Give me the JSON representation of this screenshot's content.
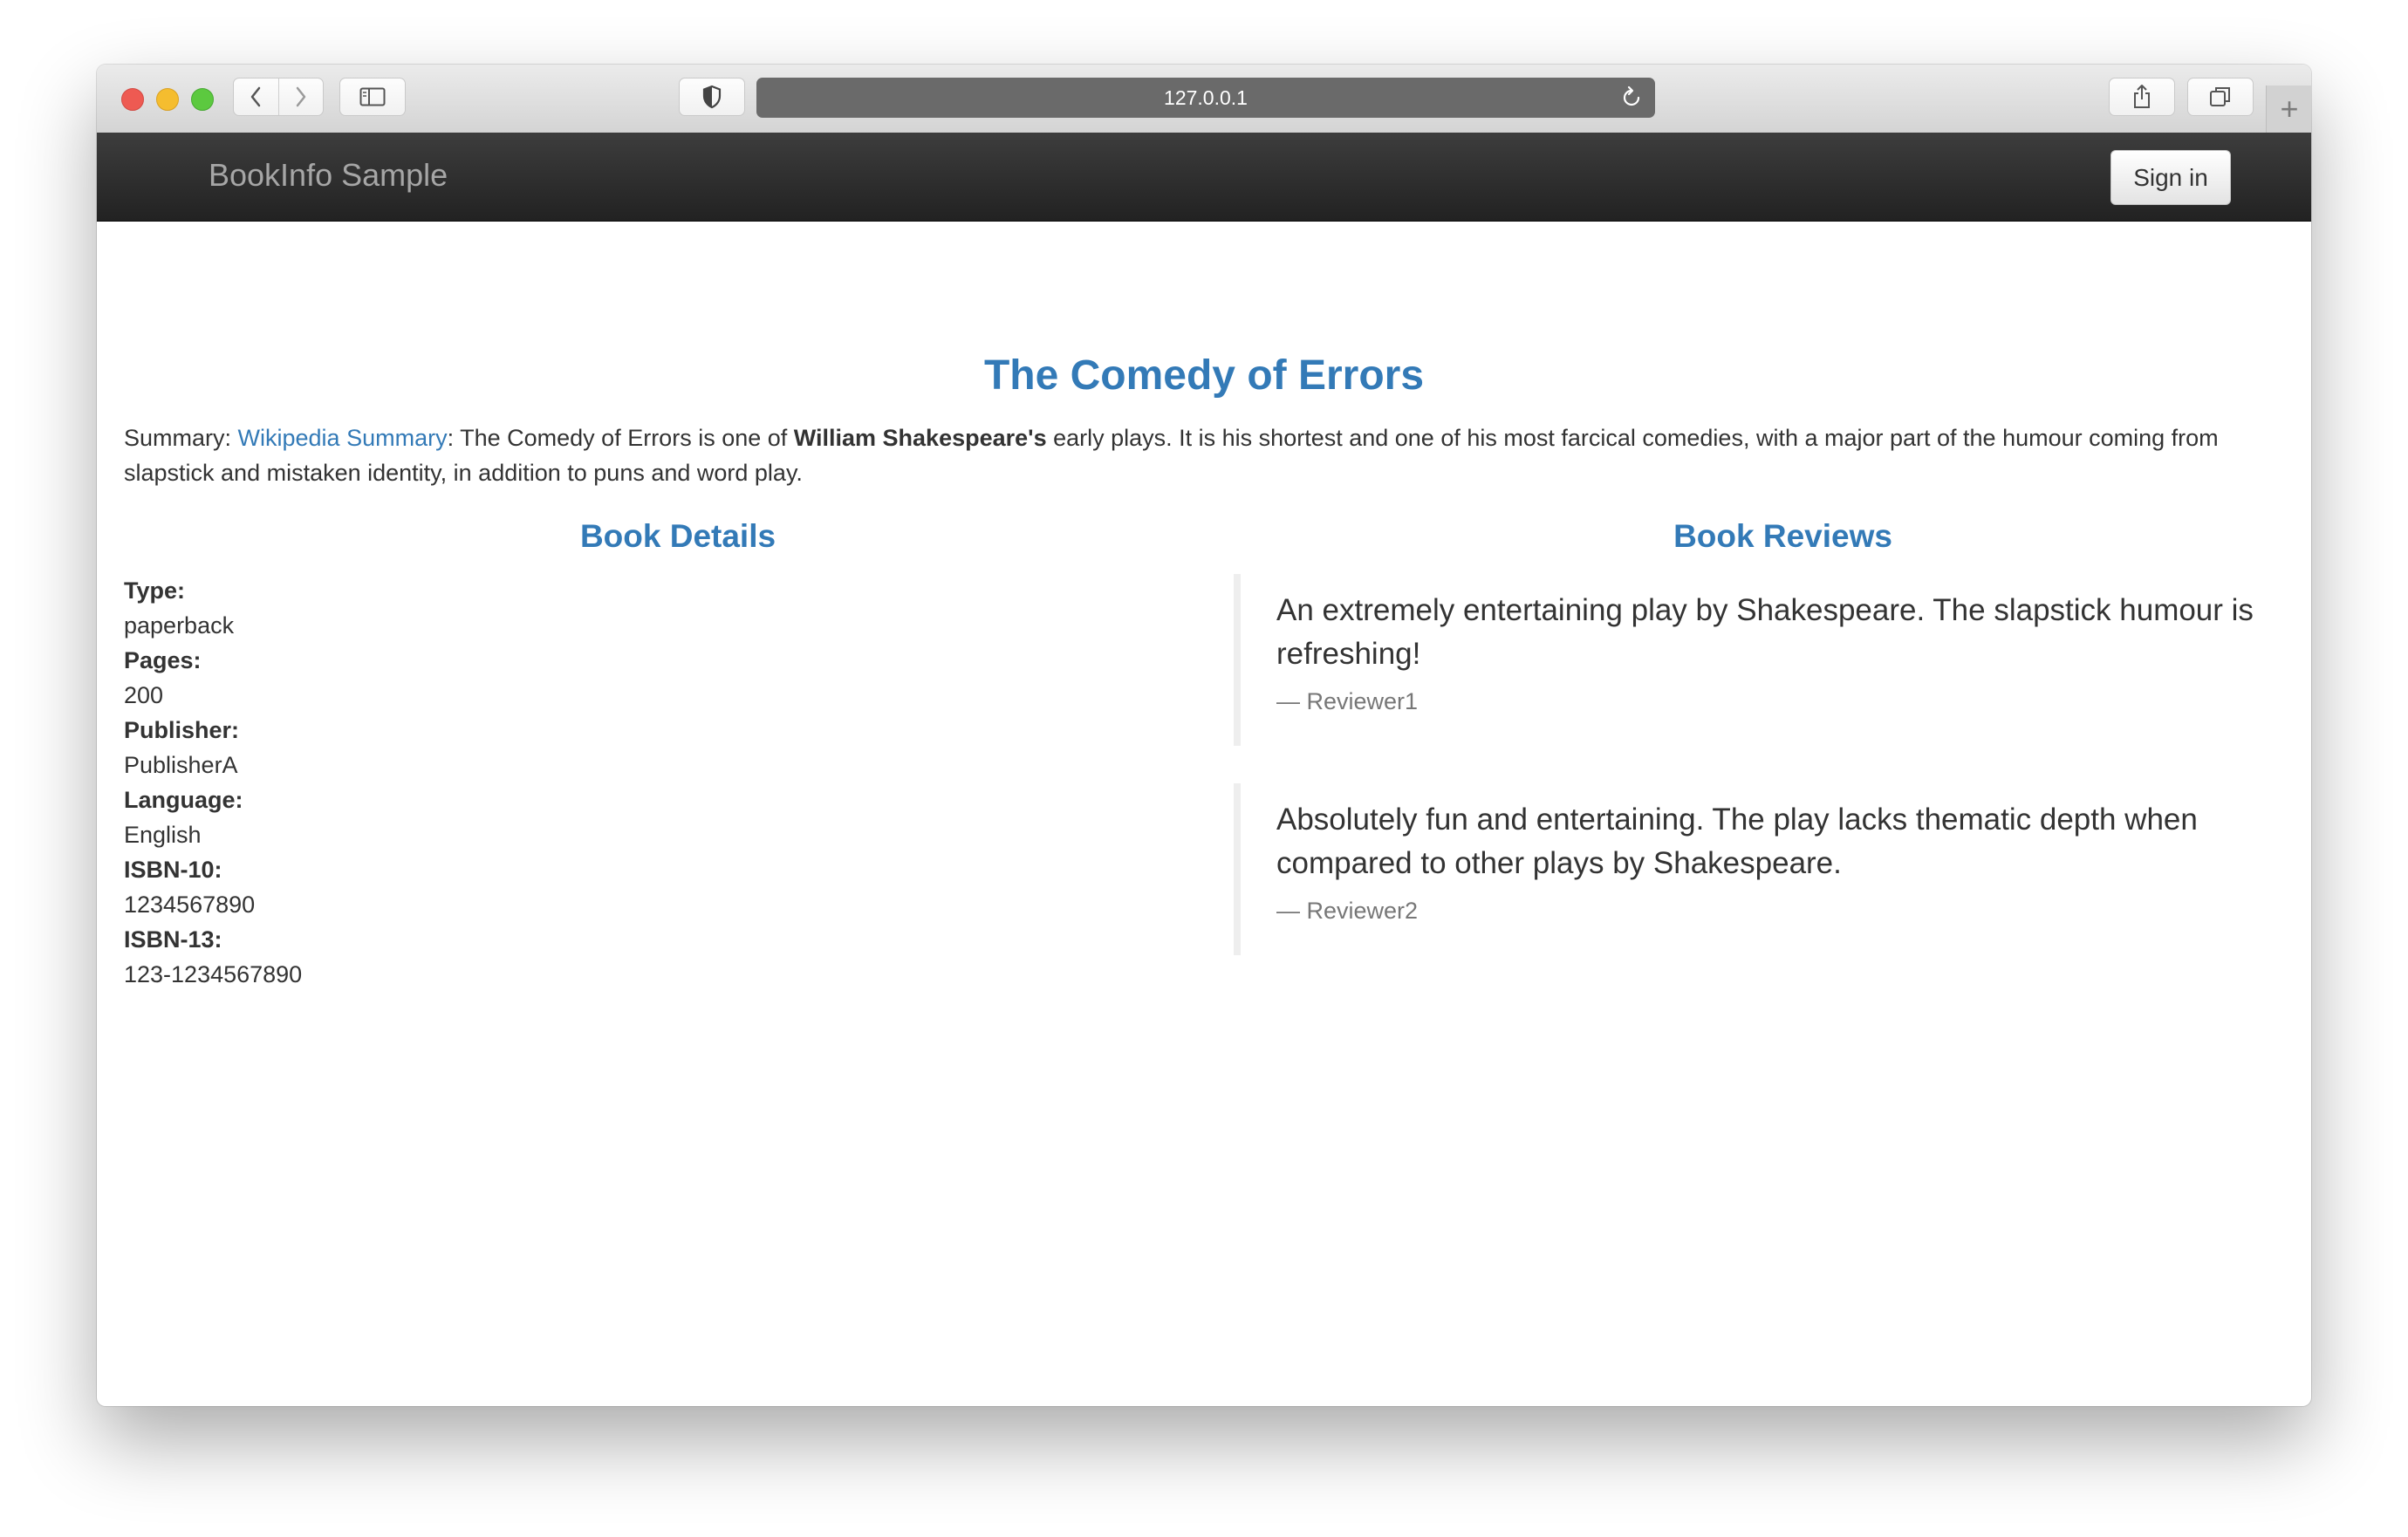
{
  "browser": {
    "url": "127.0.0.1",
    "new_tab_symbol": "+"
  },
  "navbar": {
    "brand": "BookInfo Sample",
    "signin_label": "Sign in"
  },
  "book": {
    "title": "The Comedy of Errors",
    "summary": {
      "prefix": "Summary: ",
      "link_label": "Wikipedia Summary",
      "text_before": ": The Comedy of Errors is one of ",
      "bold": "William Shakespeare's",
      "text_after": " early plays. It is his shortest and one of his most farcical comedies, with a major part of the humour coming from slapstick and mistaken identity, in addition to puns and word play."
    }
  },
  "details": {
    "heading": "Book Details",
    "items": [
      {
        "label": "Type:",
        "value": "paperback"
      },
      {
        "label": "Pages:",
        "value": "200"
      },
      {
        "label": "Publisher:",
        "value": "PublisherA"
      },
      {
        "label": "Language:",
        "value": "English"
      },
      {
        "label": "ISBN-10:",
        "value": "1234567890"
      },
      {
        "label": "ISBN-13:",
        "value": "123-1234567890"
      }
    ]
  },
  "reviews": {
    "heading": "Book Reviews",
    "items": [
      {
        "text": "An extremely entertaining play by Shakespeare. The slapstick humour is refreshing!",
        "author": "— Reviewer1"
      },
      {
        "text": "Absolutely fun and entertaining. The play lacks thematic depth when compared to other plays by Shakespeare.",
        "author": "— Reviewer2"
      }
    ]
  },
  "colors": {
    "link": "#337ab7",
    "navbar": "#222222",
    "text": "#333333"
  }
}
